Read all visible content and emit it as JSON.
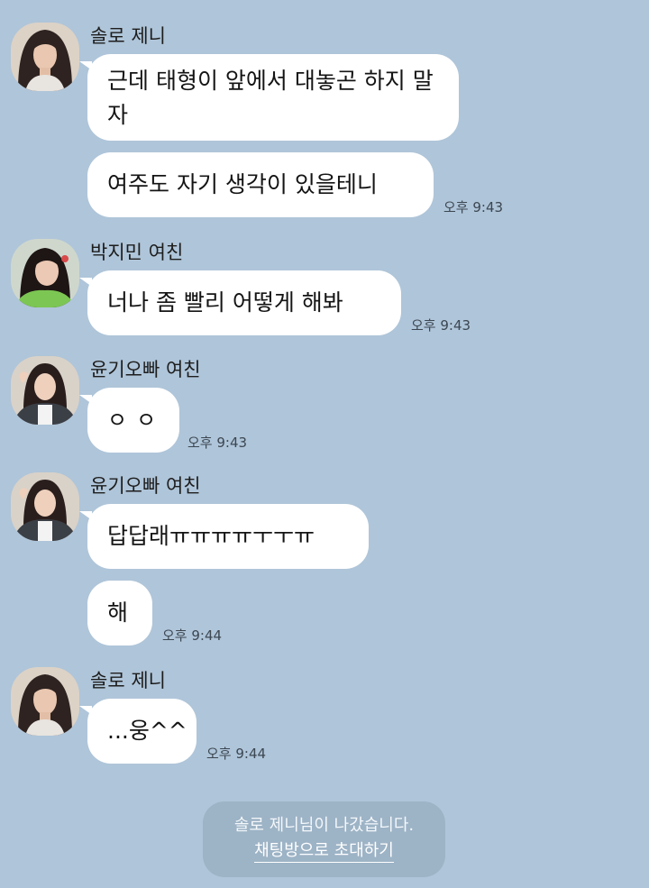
{
  "colors": {
    "background": "#afc5d9",
    "bubble": "#ffffff",
    "notice_background": "#9db3c6"
  },
  "messages": [
    {
      "sender": "솔로 제니",
      "bubbles": [
        "근데 태형이 앞에서 대놓곤 하지 말자",
        "여주도 자기 생각이 있을테니"
      ],
      "time": "오후 9:43"
    },
    {
      "sender": "박지민 여친",
      "bubbles": [
        "너나 좀 빨리 어떻게 해봐"
      ],
      "time": "오후 9:43"
    },
    {
      "sender": "윤기오빠 여친",
      "bubbles": [
        "ㅇㅇ"
      ],
      "time": "오후 9:43"
    },
    {
      "sender": "윤기오빠 여친",
      "bubbles": [
        "답답래ㅠㅠㅠㅠㅜㅜㅠ",
        "해"
      ],
      "time": "오후 9:44"
    },
    {
      "sender": "솔로 제니",
      "bubbles": [
        "...웅^^"
      ],
      "time": "오후 9:44"
    }
  ],
  "notice": {
    "text": "솔로 제니님이 나갔습니다.",
    "link": "채팅방으로 초대하기"
  }
}
